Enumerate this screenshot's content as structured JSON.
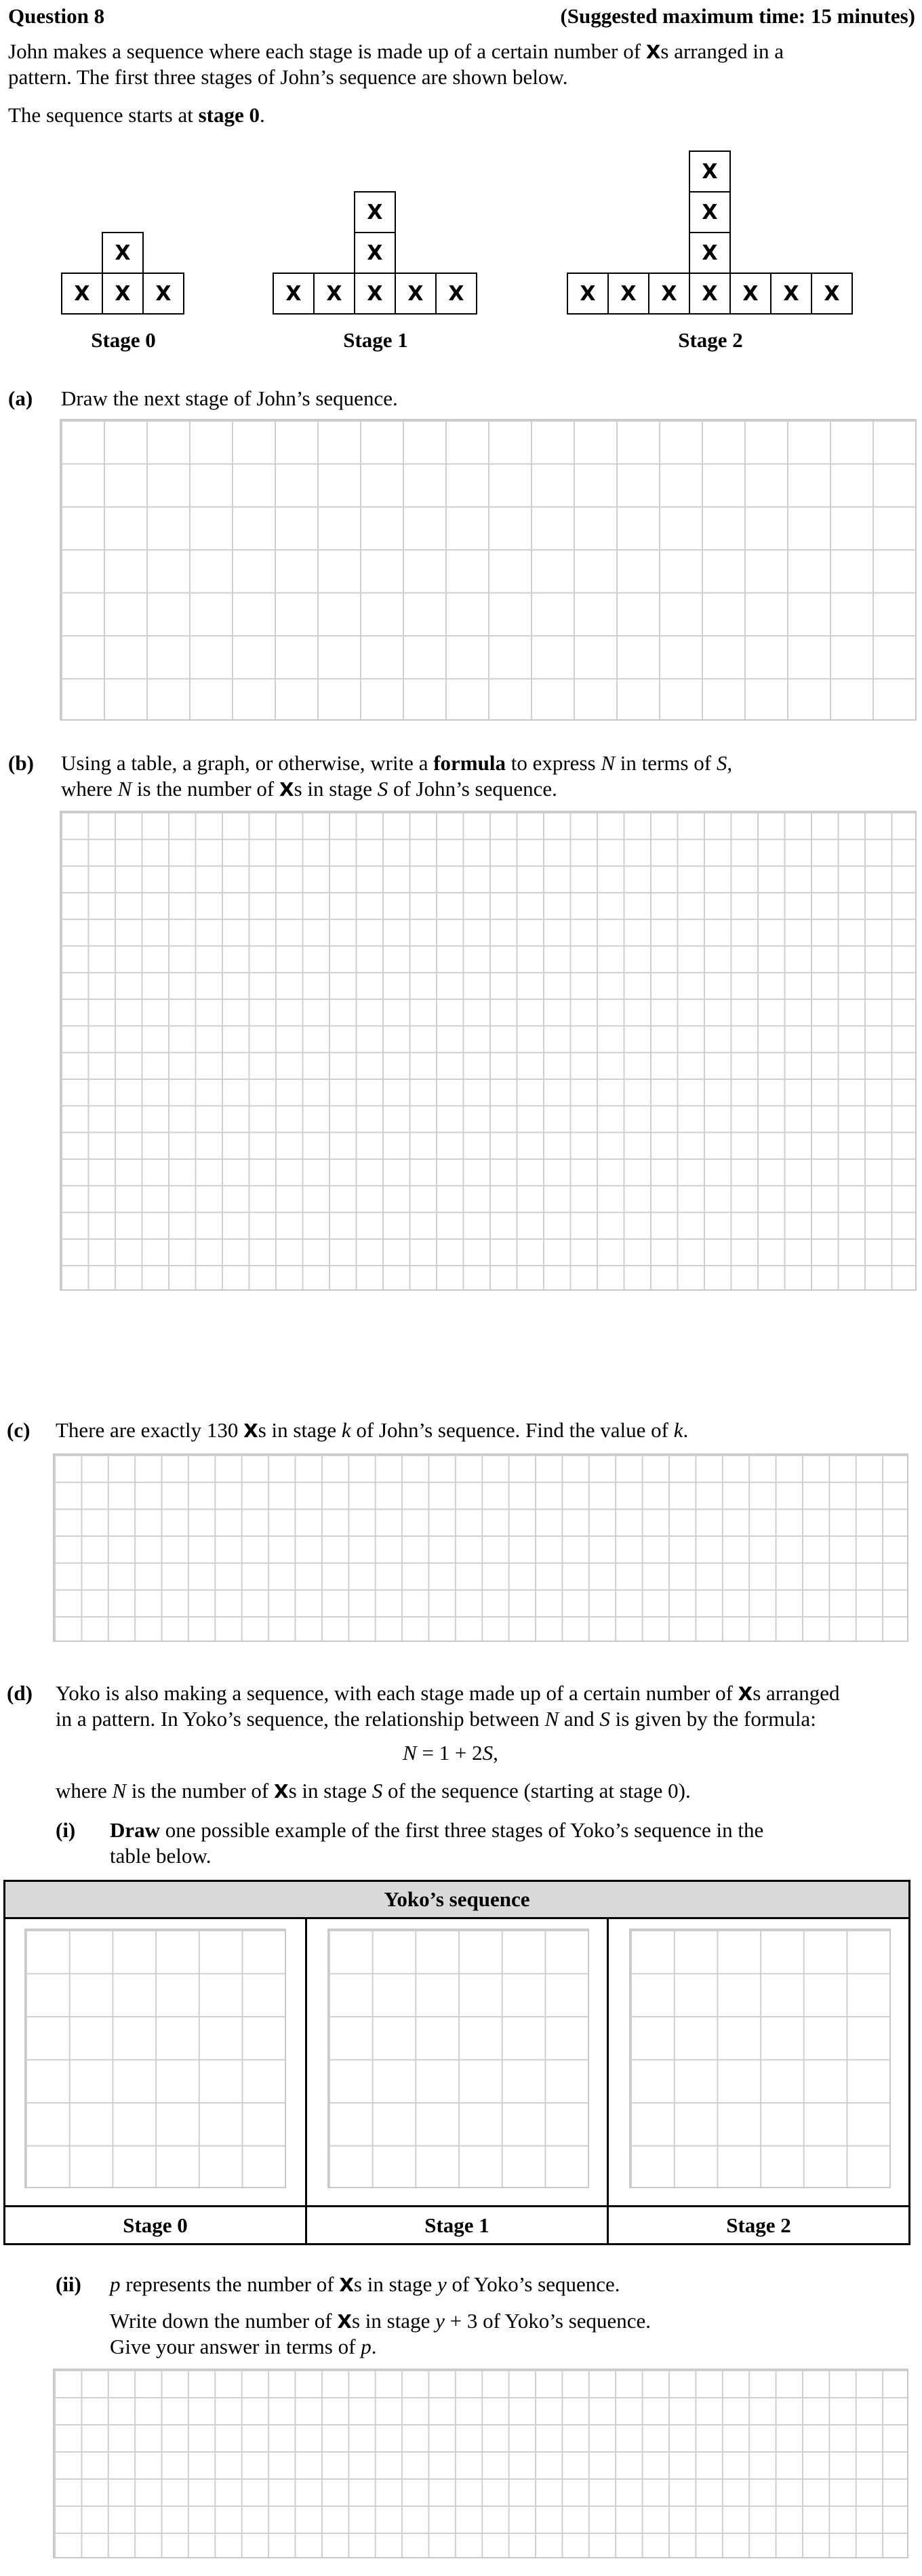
{
  "header": {
    "question": "Question 8",
    "time": "(Suggested maximum time: 15 minutes)"
  },
  "intro": {
    "line1_pre": "John makes a sequence where each stage is made up of a certain number of",
    "x_glyph": "X",
    "line1_post": "s arranged in a",
    "line2": "pattern.  The first three stages of John’s sequence are shown below.",
    "line3_pre": "The sequence starts at ",
    "line3_bold": "stage 0",
    "line3_post": "."
  },
  "figure": {
    "cell_mark": "X",
    "stage0": "Stage 0",
    "stage1": "Stage 1",
    "stage2": "Stage 2"
  },
  "part_a": {
    "label": "(a)",
    "text": "Draw the next stage of John’s sequence."
  },
  "part_b": {
    "label": "(b)",
    "l1_a": "Using a table, a graph, or otherwise, write a ",
    "l1_bold": "formula",
    "l1_b": " to express ",
    "N": "N",
    "l1_c": " in terms of ",
    "S": "S",
    "l1_d": ",",
    "l2_a": "where ",
    "l2_b": " is the number of ",
    "x_glyph": "X",
    "l2_c": "s  in stage ",
    "l2_d": " of John’s sequence."
  },
  "part_c": {
    "label": "(c)",
    "t1": "There are exactly  130 ",
    "x_glyph": "X",
    "t2": "s  in stage ",
    "k": "k",
    "t3": " of John’s sequence.  Find the value of ",
    "t4": "."
  },
  "part_d": {
    "label": "(d)",
    "l1_a": "Yoko is also making a sequence, with each stage made up of a certain number of",
    "x_glyph": "X",
    "l1_b": "s arranged",
    "l2_a": "in a pattern.  In Yoko’s sequence, the relationship between ",
    "N": "N",
    "l2_b": " and ",
    "S": "S",
    "l2_c": " is given by the formula:",
    "formula_N": "N",
    "formula_mid": " = 1 + 2",
    "formula_S": "S",
    "formula_end": ",",
    "l3_a": "where ",
    "l3_b": " is the number of ",
    "l3_c": "s  in stage ",
    "l3_d": " of the sequence (starting at stage 0).",
    "sub_i_label": "(i)",
    "sub_i_bold": "Draw",
    "sub_i_text": " one possible example of the first three stages of Yoko’s sequence in the",
    "sub_i_text2": "table below.",
    "table_title": "Yoko’s sequence",
    "stage0": "Stage 0",
    "stage1": "Stage 1",
    "stage2": "Stage 2",
    "sub_ii_label": "(ii)",
    "p": "p",
    "ii_l1_a": " represents the number of ",
    "ii_l1_b": "s  in stage ",
    "y": "y",
    "ii_l1_c": " of Yoko’s sequence.",
    "ii_l2_a": "Write down the number of ",
    "ii_l2_b": "s  in stage ",
    "ii_l2_c": " + 3  of Yoko’s sequence.",
    "ii_l3_a": "Give your answer in terms of ",
    "ii_l3_b": "."
  }
}
